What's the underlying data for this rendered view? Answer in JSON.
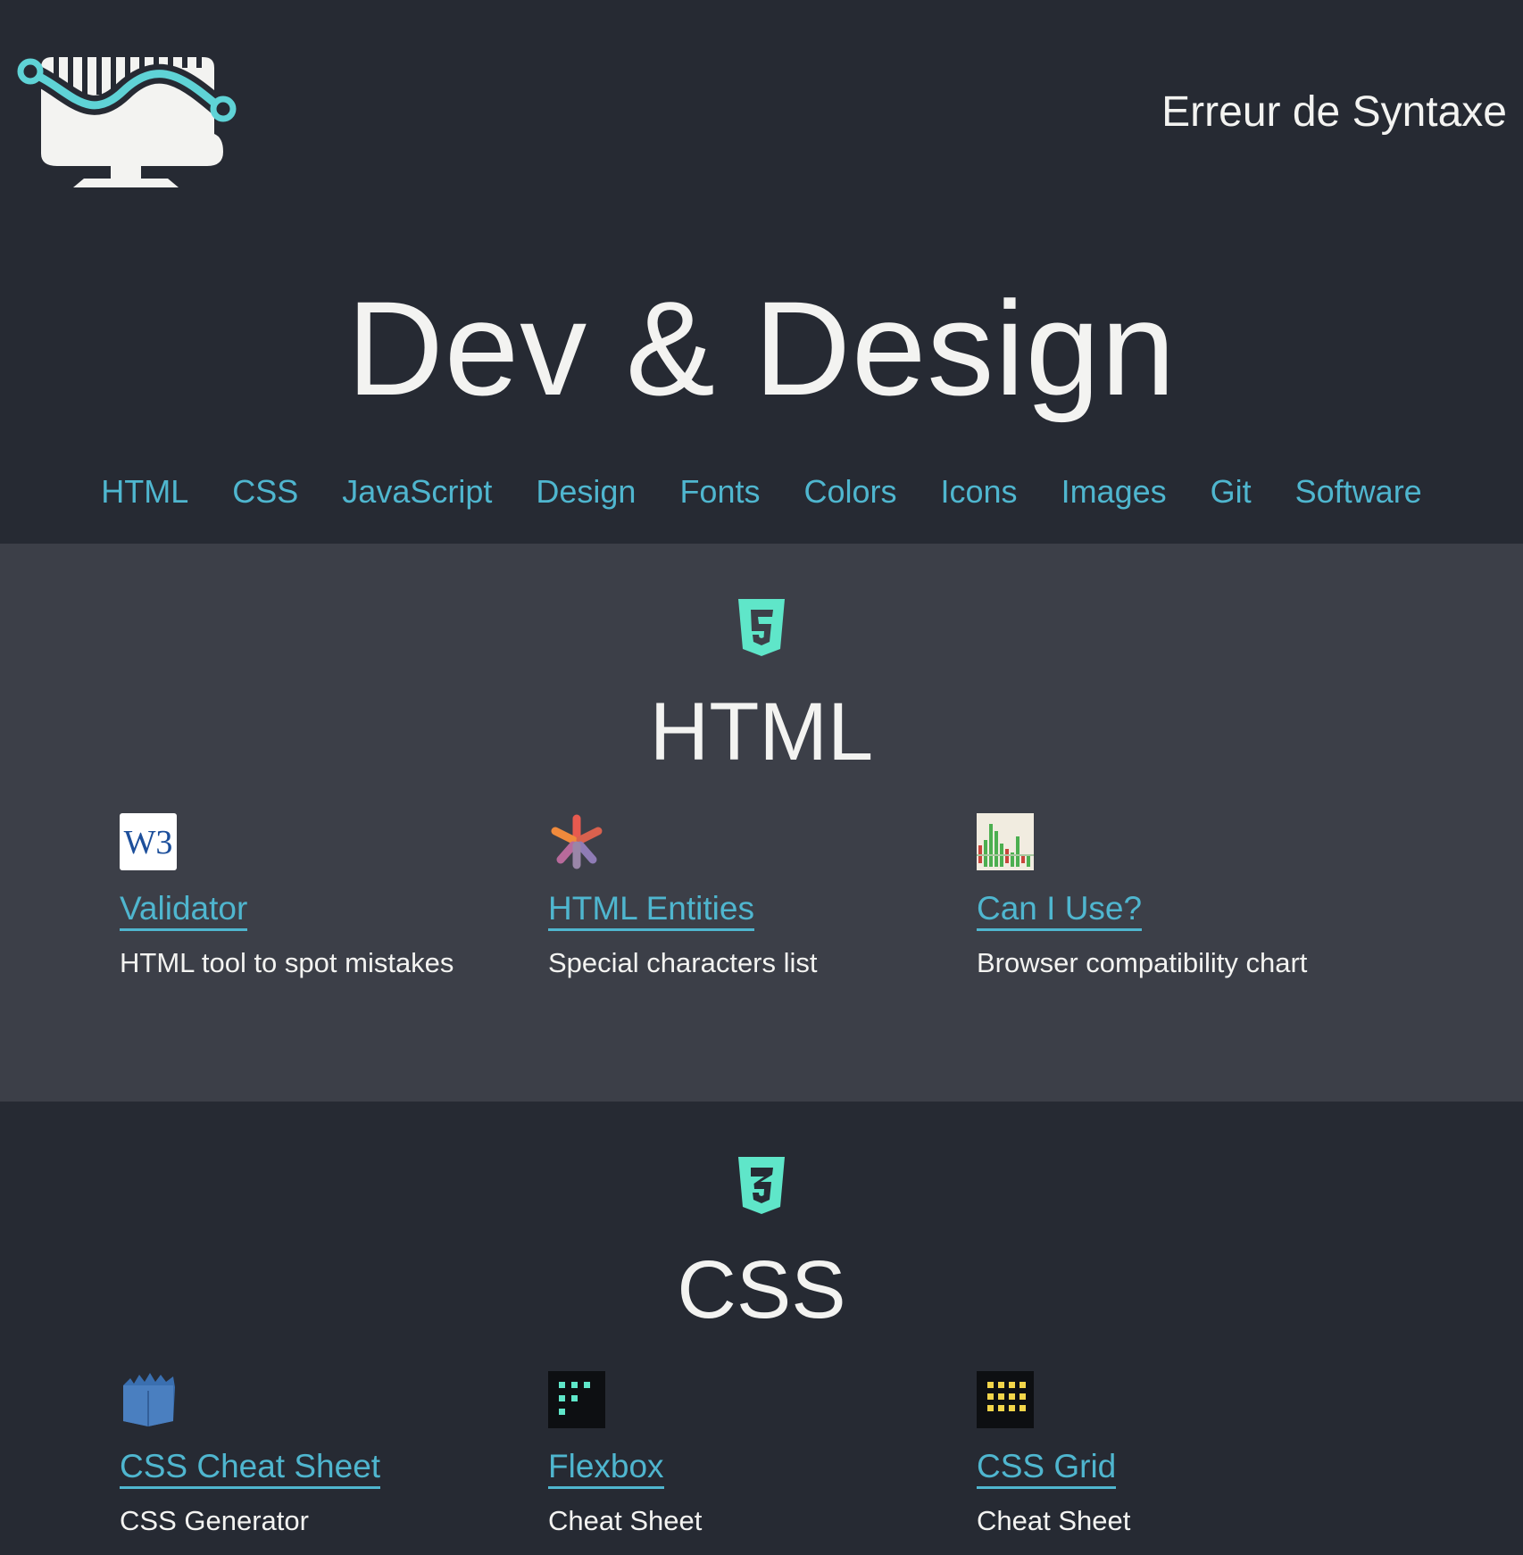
{
  "header": {
    "logo_icon": "monitor-wave-logo",
    "brand": "Erreur de Syntaxe",
    "title": "Dev & Design"
  },
  "nav": [
    "HTML",
    "CSS",
    "JavaScript",
    "Design",
    "Fonts",
    "Colors",
    "Icons",
    "Images",
    "Git",
    "Software"
  ],
  "sections": [
    {
      "icon": "html5-icon",
      "title": "HTML",
      "cards": [
        {
          "icon": "w3c-icon",
          "icon_text": "W3",
          "label": "Validator",
          "desc": "HTML tool to spot mistakes"
        },
        {
          "icon": "asterisk-icon",
          "label": "HTML Entities",
          "desc": "Special characters list"
        },
        {
          "icon": "chart-icon",
          "label": "Can I Use?",
          "desc": "Browser compatibility chart"
        }
      ]
    },
    {
      "icon": "css3-icon",
      "title": "CSS",
      "cards": [
        {
          "icon": "cube-icon",
          "label": "CSS Cheat Sheet",
          "desc": "CSS Generator"
        },
        {
          "icon": "flexbox-dots-icon",
          "label": "Flexbox",
          "desc": "Cheat Sheet"
        },
        {
          "icon": "grid-dots-icon",
          "label": "CSS Grid",
          "desc": "Cheat Sheet"
        }
      ]
    }
  ],
  "colors": {
    "background": "#262a33",
    "section_alt": "#3c3f48",
    "link": "#4fb6cf",
    "accent": "#5fe6c9",
    "text": "#f3f3f1"
  }
}
